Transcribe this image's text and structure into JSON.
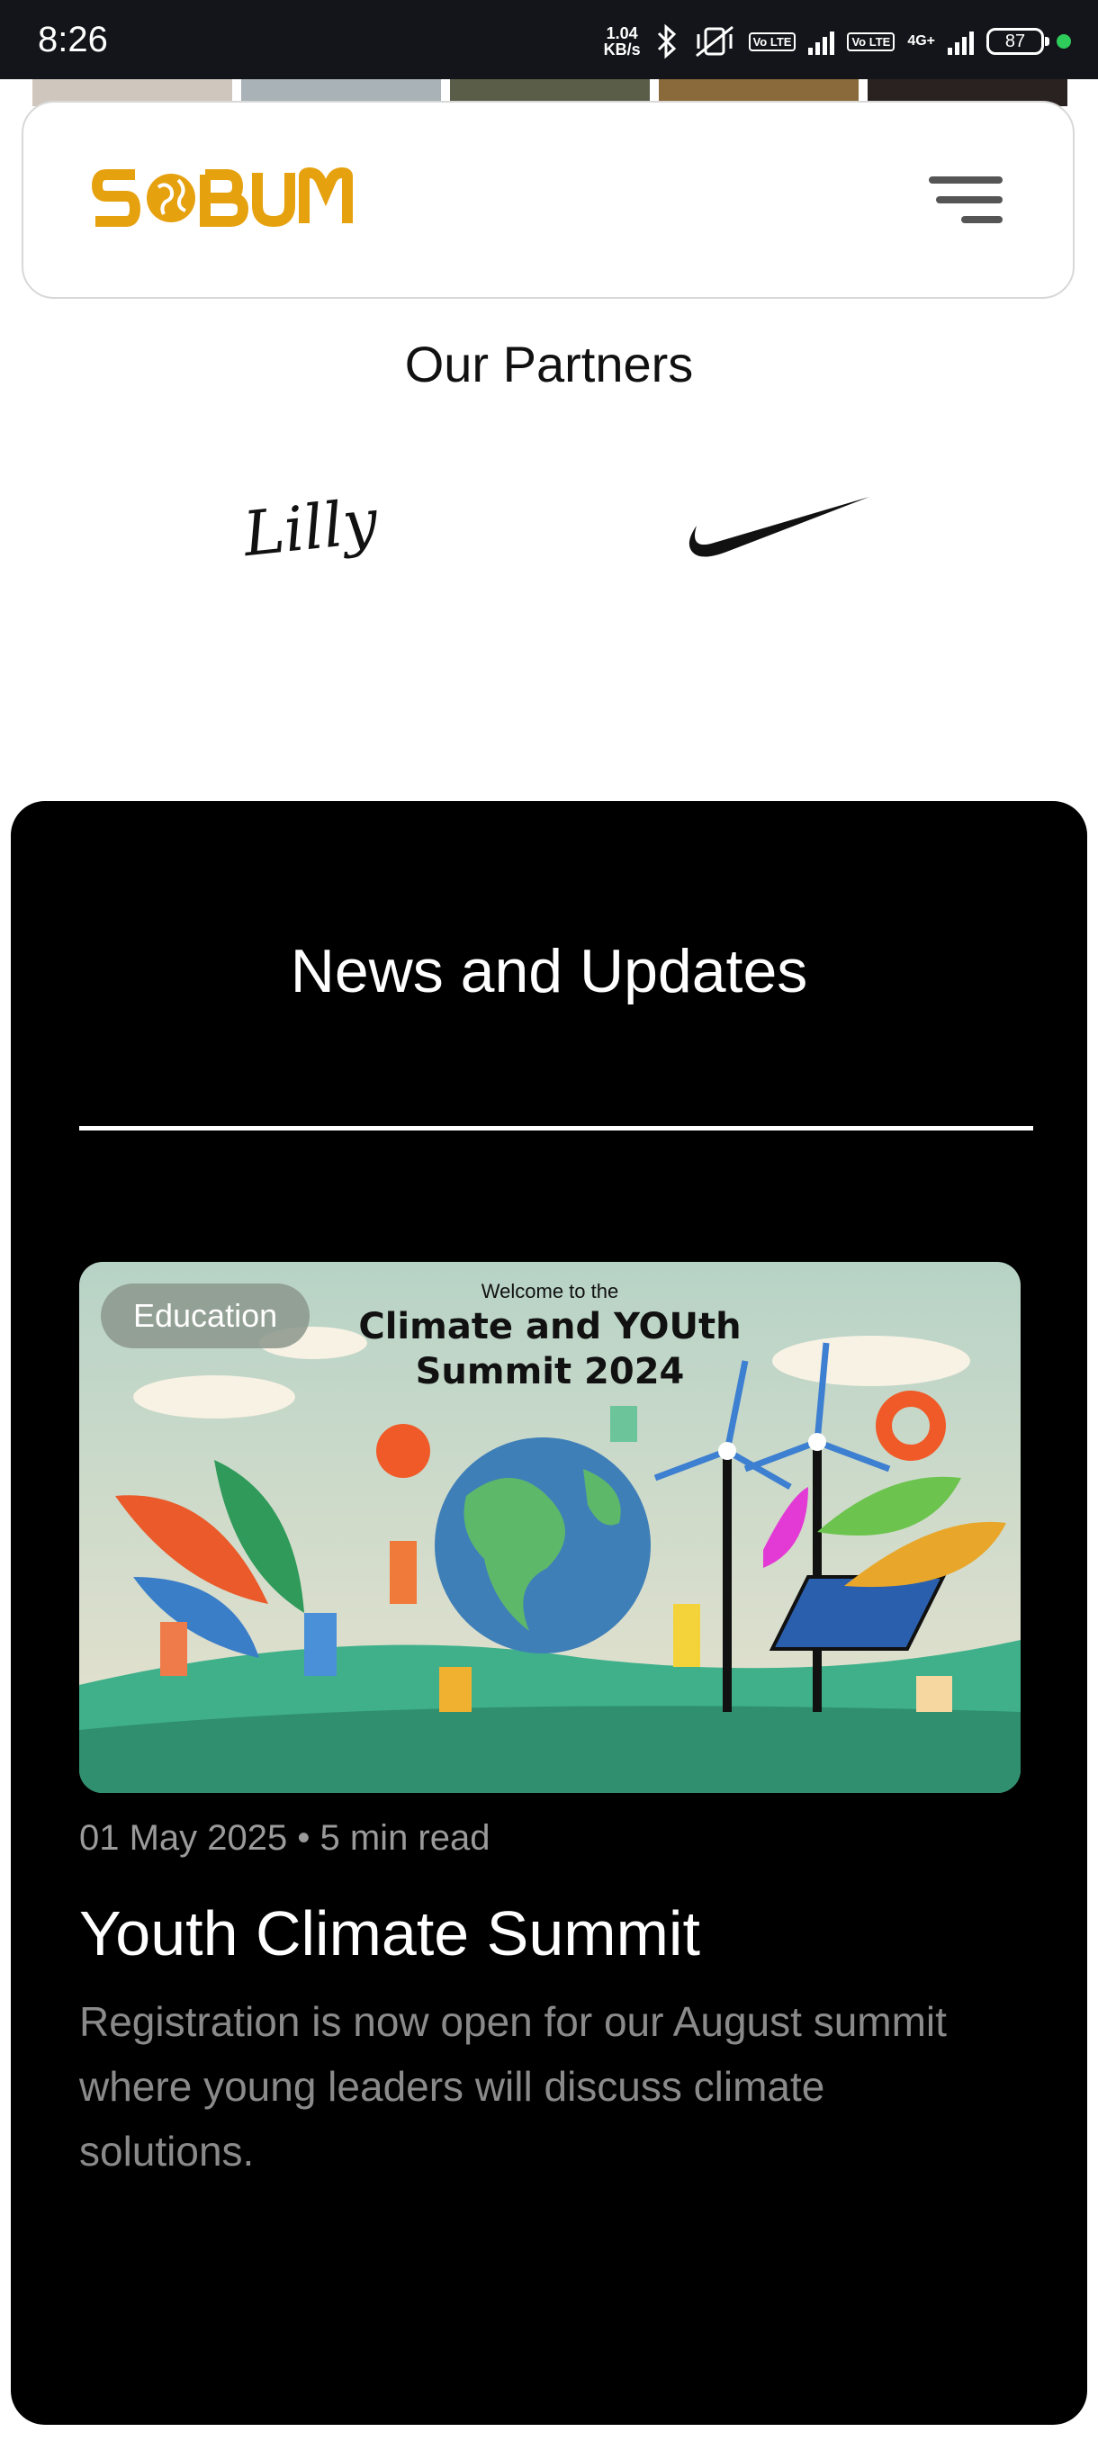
{
  "status_bar": {
    "time": "8:26",
    "net_speed_value": "1.04",
    "net_speed_unit": "KB/s",
    "lte_label": "Vo LTE",
    "lte_label_2": "Vo LTE",
    "network_type": "4G+",
    "battery": "87"
  },
  "header": {
    "logo_text": "S•BUM",
    "brand_color": "#e6a10f",
    "menu_icon": "hamburger-menu-icon"
  },
  "partners": {
    "title": "Our Partners",
    "logos": [
      {
        "name": "lilly-logo",
        "text": "Lilly"
      },
      {
        "name": "nike-logo",
        "text": ""
      }
    ]
  },
  "news": {
    "title": "News and Updates",
    "articles": [
      {
        "category": "Education",
        "image_caption_small": "Welcome to the",
        "image_caption_line1": "Climate and YOUth",
        "image_caption_line2": "Summit 2024",
        "meta": "01 May 2025 • 5 min read",
        "headline": "Youth Climate Summit",
        "excerpt": "Registration is now open for our August summit where young leaders will discuss climate solutions."
      }
    ]
  }
}
